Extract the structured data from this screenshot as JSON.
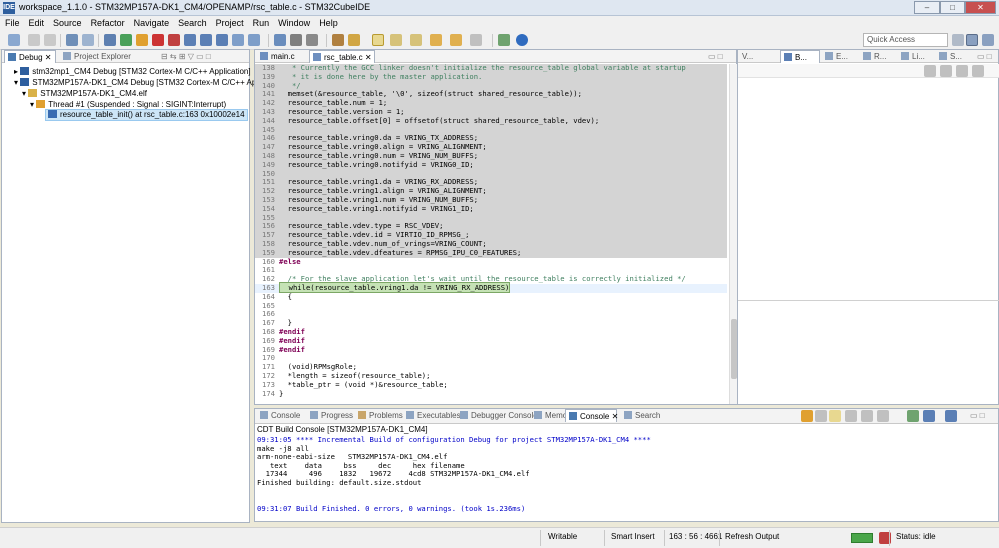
{
  "window": {
    "title": "workspace_1.1.0 - STM32MP157A-DK1_CM4/OPENAMP/rsc_table.c - STM32CubeIDE",
    "app_icon": "IDE"
  },
  "menu": [
    "File",
    "Edit",
    "Source",
    "Refactor",
    "Navigate",
    "Search",
    "Project",
    "Run",
    "Window",
    "Help"
  ],
  "toolbar": {
    "quick_access": "Quick Access"
  },
  "debug_view": {
    "tabs": [
      "Debug",
      "Project Explorer"
    ],
    "tree": [
      "stm32mp1_CM4 Debug [STM32 Cortex-M C/C++ Application]",
      "STM32MP157A-DK1_CM4 Debug [STM32 Cortex-M C/C++ Application]",
      "STM32MP157A-DK1_CM4.elf",
      "Thread #1 (Suspended : Signal : SIGINT:Interrupt)",
      "resource_table_init() at rsc_table.c:163 0x10002e14"
    ]
  },
  "editor": {
    "tabs": [
      "main.c",
      "rsc_table.c"
    ],
    "lines": [
      {
        "n": "138",
        "t": "   * Currently the GCC linker doesn't initialize the resource_table global variable at startup",
        "c": "cm",
        "g": true
      },
      {
        "n": "139",
        "t": "   * it is done here by the master application.",
        "c": "cm",
        "g": true
      },
      {
        "n": "140",
        "t": "   */",
        "c": "cm",
        "g": true
      },
      {
        "n": "141",
        "t": "  memset(&resource_table, '\\0', sizeof(struct shared_resource_table));",
        "g": true
      },
      {
        "n": "142",
        "t": "  resource_table.num = 1;",
        "g": true
      },
      {
        "n": "143",
        "t": "  resource_table.version = 1;",
        "g": true
      },
      {
        "n": "144",
        "t": "  resource_table.offset[0] = offsetof(struct shared_resource_table, vdev);",
        "g": true
      },
      {
        "n": "145",
        "t": "",
        "g": true
      },
      {
        "n": "146",
        "t": "  resource_table.vring0.da = VRING_TX_ADDRESS;",
        "g": true
      },
      {
        "n": "147",
        "t": "  resource_table.vring0.align = VRING_ALIGNMENT;",
        "g": true
      },
      {
        "n": "148",
        "t": "  resource_table.vring0.num = VRING_NUM_BUFFS;",
        "g": true
      },
      {
        "n": "149",
        "t": "  resource_table.vring0.notifyid = VRING0_ID;",
        "g": true
      },
      {
        "n": "150",
        "t": "",
        "g": true
      },
      {
        "n": "151",
        "t": "  resource_table.vring1.da = VRING_RX_ADDRESS;",
        "g": true
      },
      {
        "n": "152",
        "t": "  resource_table.vring1.align = VRING_ALIGNMENT;",
        "g": true
      },
      {
        "n": "153",
        "t": "  resource_table.vring1.num = VRING_NUM_BUFFS;",
        "g": true
      },
      {
        "n": "154",
        "t": "  resource_table.vring1.notifyid = VRING1_ID;",
        "g": true
      },
      {
        "n": "155",
        "t": "",
        "g": true
      },
      {
        "n": "156",
        "t": "  resource_table.vdev.type = RSC_VDEV;",
        "g": true
      },
      {
        "n": "157",
        "t": "  resource_table.vdev.id = VIRTIO_ID_RPMSG_;",
        "g": true
      },
      {
        "n": "158",
        "t": "  resource_table.vdev.num_of_vrings=VRING_COUNT;",
        "g": true
      },
      {
        "n": "159",
        "t": "  resource_table.vdev.dfeatures = RPMSG_IPU_C0_FEATURES;",
        "g": true
      },
      {
        "n": "160",
        "t": "#else",
        "c": "kw"
      },
      {
        "n": "161",
        "t": ""
      },
      {
        "n": "162",
        "t": "  /* For the slave application let's wait until the resource_table is correctly initialized */",
        "c": "cm"
      },
      {
        "n": "163",
        "t": "  while(resource_table.vring1.da != VRING_RX_ADDRESS)",
        "cur": true
      },
      {
        "n": "164",
        "t": "  {"
      },
      {
        "n": "165",
        "t": ""
      },
      {
        "n": "166",
        "t": ""
      },
      {
        "n": "167",
        "t": "  }"
      },
      {
        "n": "168",
        "t": "#endif",
        "c": "kw"
      },
      {
        "n": "169",
        "t": "#endif",
        "c": "kw"
      },
      {
        "n": "169",
        "t": "#endif",
        "c": "kw"
      },
      {
        "n": "170",
        "t": ""
      },
      {
        "n": "171",
        "t": "  (void)RPMsgRole;"
      },
      {
        "n": "172",
        "t": "  *length = sizeof(resource_table);"
      },
      {
        "n": "173",
        "t": "  *table_ptr = (void *)&resource_table;"
      },
      {
        "n": "174",
        "t": "}"
      }
    ]
  },
  "outline_view": {
    "tabs": [
      "V...",
      "B...",
      "E...",
      "R...",
      "Li...",
      "S..."
    ]
  },
  "console_view": {
    "tabs": [
      "Console",
      "Progress",
      "Problems",
      "Executables",
      "Debugger Console",
      "Memory",
      "Console",
      "Search"
    ],
    "header": "CDT Build Console [STM32MP157A-DK1_CM4]",
    "lines": [
      {
        "t": "09:31:05 **** Incremental Build of configuration Debug for project STM32MP157A-DK1_CM4 ****",
        "blue": true
      },
      {
        "t": "make -j8 all"
      },
      {
        "t": "arm-none-eabi-size   STM32MP157A-DK1_CM4.elf"
      },
      {
        "t": "   text    data     bss     dec     hex filename"
      },
      {
        "t": "  17344     496    1832   19672    4cd8 STM32MP157A-DK1_CM4.elf"
      },
      {
        "t": "Finished building: default.size.stdout"
      },
      {
        "t": ""
      },
      {
        "t": ""
      },
      {
        "t": "09:31:07 Build Finished. 0 errors, 0 warnings. (took 1s.236ms)",
        "blue": true
      }
    ]
  },
  "status_bar": {
    "writable": "Writable",
    "insert_mode": "Smart Insert",
    "position": "163 : 56 : 4661",
    "refresh": "Refresh Output",
    "status": "Status: idle"
  },
  "colors": {
    "accent": "#2f5f9e",
    "grey_code": "#d4d4d4",
    "current_line": "#e8f2fe",
    "console_blue": "#0000c8"
  }
}
